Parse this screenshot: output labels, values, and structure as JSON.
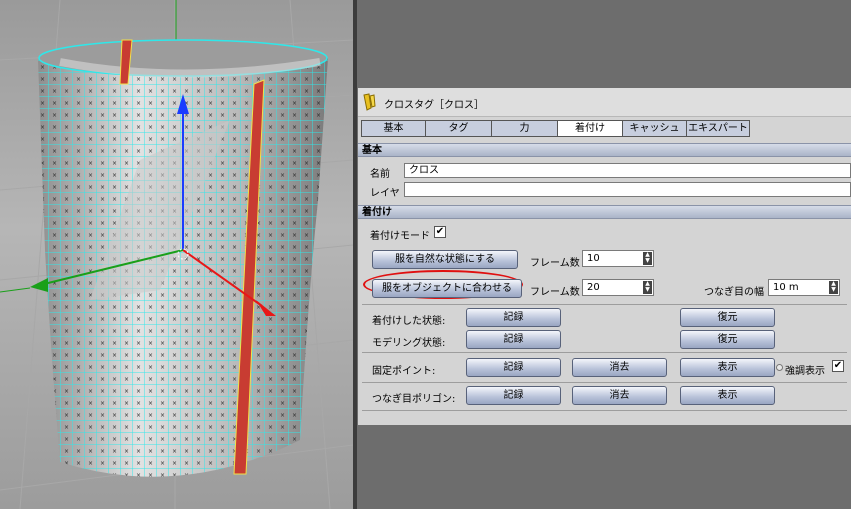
{
  "panel": {
    "title": "クロスタグ［クロス］",
    "tabs": [
      "基本",
      "タグ",
      "力",
      "着付け",
      "キャッシュ",
      "エキスパート"
    ],
    "active_tab": "着付け",
    "basic_section": {
      "header": "基本",
      "name_label": "名前",
      "name_value": "クロス",
      "layer_label": "レイヤ",
      "layer_value": ""
    },
    "dressing_section": {
      "header": "着付け",
      "dress_mode_label": "着付けモード",
      "dress_mode_checked": true,
      "relax_button": "服を自然な状態にする",
      "relax_frames_label": "フレーム数",
      "relax_frames_value": "10",
      "fit_button": "服をオブジェクトに合わせる",
      "fit_frames_label": "フレーム数",
      "fit_frames_value": "20",
      "seam_width_label": "つなぎ目の幅",
      "seam_width_value": "10 m",
      "dressed_state_label": "着付けした状態:",
      "modeling_state_label": "モデリング状態:",
      "fixed_points_label": "固定ポイント:",
      "seam_polygons_label": "つなぎ目ポリゴン:",
      "record_label": "記録",
      "restore_label": "復元",
      "clear_label": "消去",
      "show_label": "表示",
      "highlight_label": "強調表示",
      "highlight_checked": true
    }
  },
  "colors": {
    "mesh_wire": "#2ee8ea",
    "seam_red": "#c83c32",
    "axis_y": "#1a3cff",
    "axis_x": "#e81818",
    "axis_z": "#1aa01a",
    "highlight_ring": "#e01010",
    "tab_active": "#ffffff",
    "tab_inactive": "#c7cede"
  },
  "icons": [
    "cloth-tag-icon",
    "checkmark-icon",
    "spinner-arrows-icon"
  ]
}
